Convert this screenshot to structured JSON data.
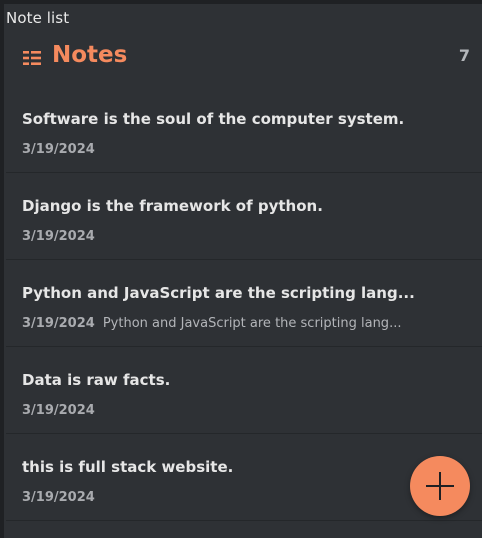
{
  "caption": "Note list",
  "header": {
    "title": "Notes",
    "count": "7"
  },
  "notes": [
    {
      "title": "Software is the soul of the computer system.",
      "date": "3/19/2024",
      "preview": ""
    },
    {
      "title": "Django is the framework of python.",
      "date": "3/19/2024",
      "preview": ""
    },
    {
      "title": "Python and JavaScript are the scripting lang...",
      "date": "3/19/2024",
      "preview": "Python and JavaScript are the scripting lang..."
    },
    {
      "title": "Data is raw facts.",
      "date": "3/19/2024",
      "preview": ""
    },
    {
      "title": "this is full stack website.",
      "date": "3/19/2024",
      "preview": ""
    }
  ],
  "colors": {
    "accent": "#f58a5e",
    "background": "#2e3135"
  },
  "icons": {
    "header": "list-menu-icon",
    "fab": "plus-icon"
  }
}
